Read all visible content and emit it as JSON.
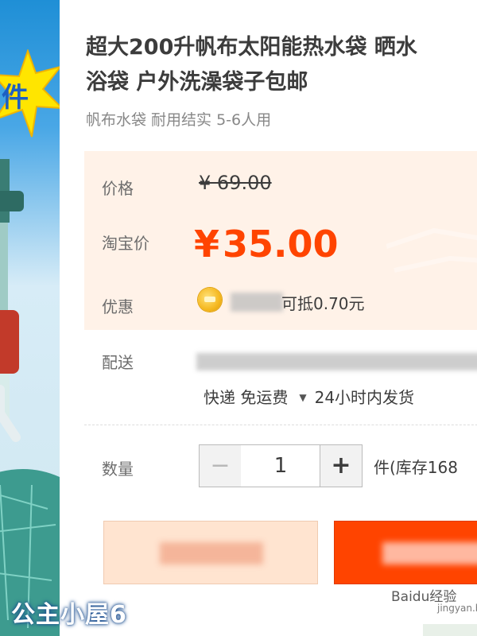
{
  "product": {
    "title_line1": "超大200升帆布太阳能热水袋 晒水",
    "title_line2": "浴袋 户外洗澡袋子包邮",
    "subtitle": "帆布水袋 耐用结实 5-6人用",
    "image_badge_text": "件"
  },
  "pricing": {
    "price_label": "价格",
    "original_price": "¥ 69.00",
    "taobao_label": "淘宝价",
    "taobao_currency": "¥",
    "taobao_price": "35.00",
    "promo_label": "优惠",
    "promo_text": "可抵0.70元"
  },
  "delivery": {
    "label": "配送",
    "method": "快递 免运费",
    "dispatch": "24小时内发货"
  },
  "quantity": {
    "label": "数量",
    "minus": "−",
    "value": "1",
    "plus": "+",
    "stock_text": "件(库存168"
  },
  "watermarks": {
    "left": "公主小屋6",
    "right": "Baidu经验",
    "url": "jingyan.baidu.com"
  },
  "colors": {
    "accent": "#ff4400",
    "panel_bg": "#fff2e8",
    "buy_button_bg": "#ffe4d0"
  }
}
